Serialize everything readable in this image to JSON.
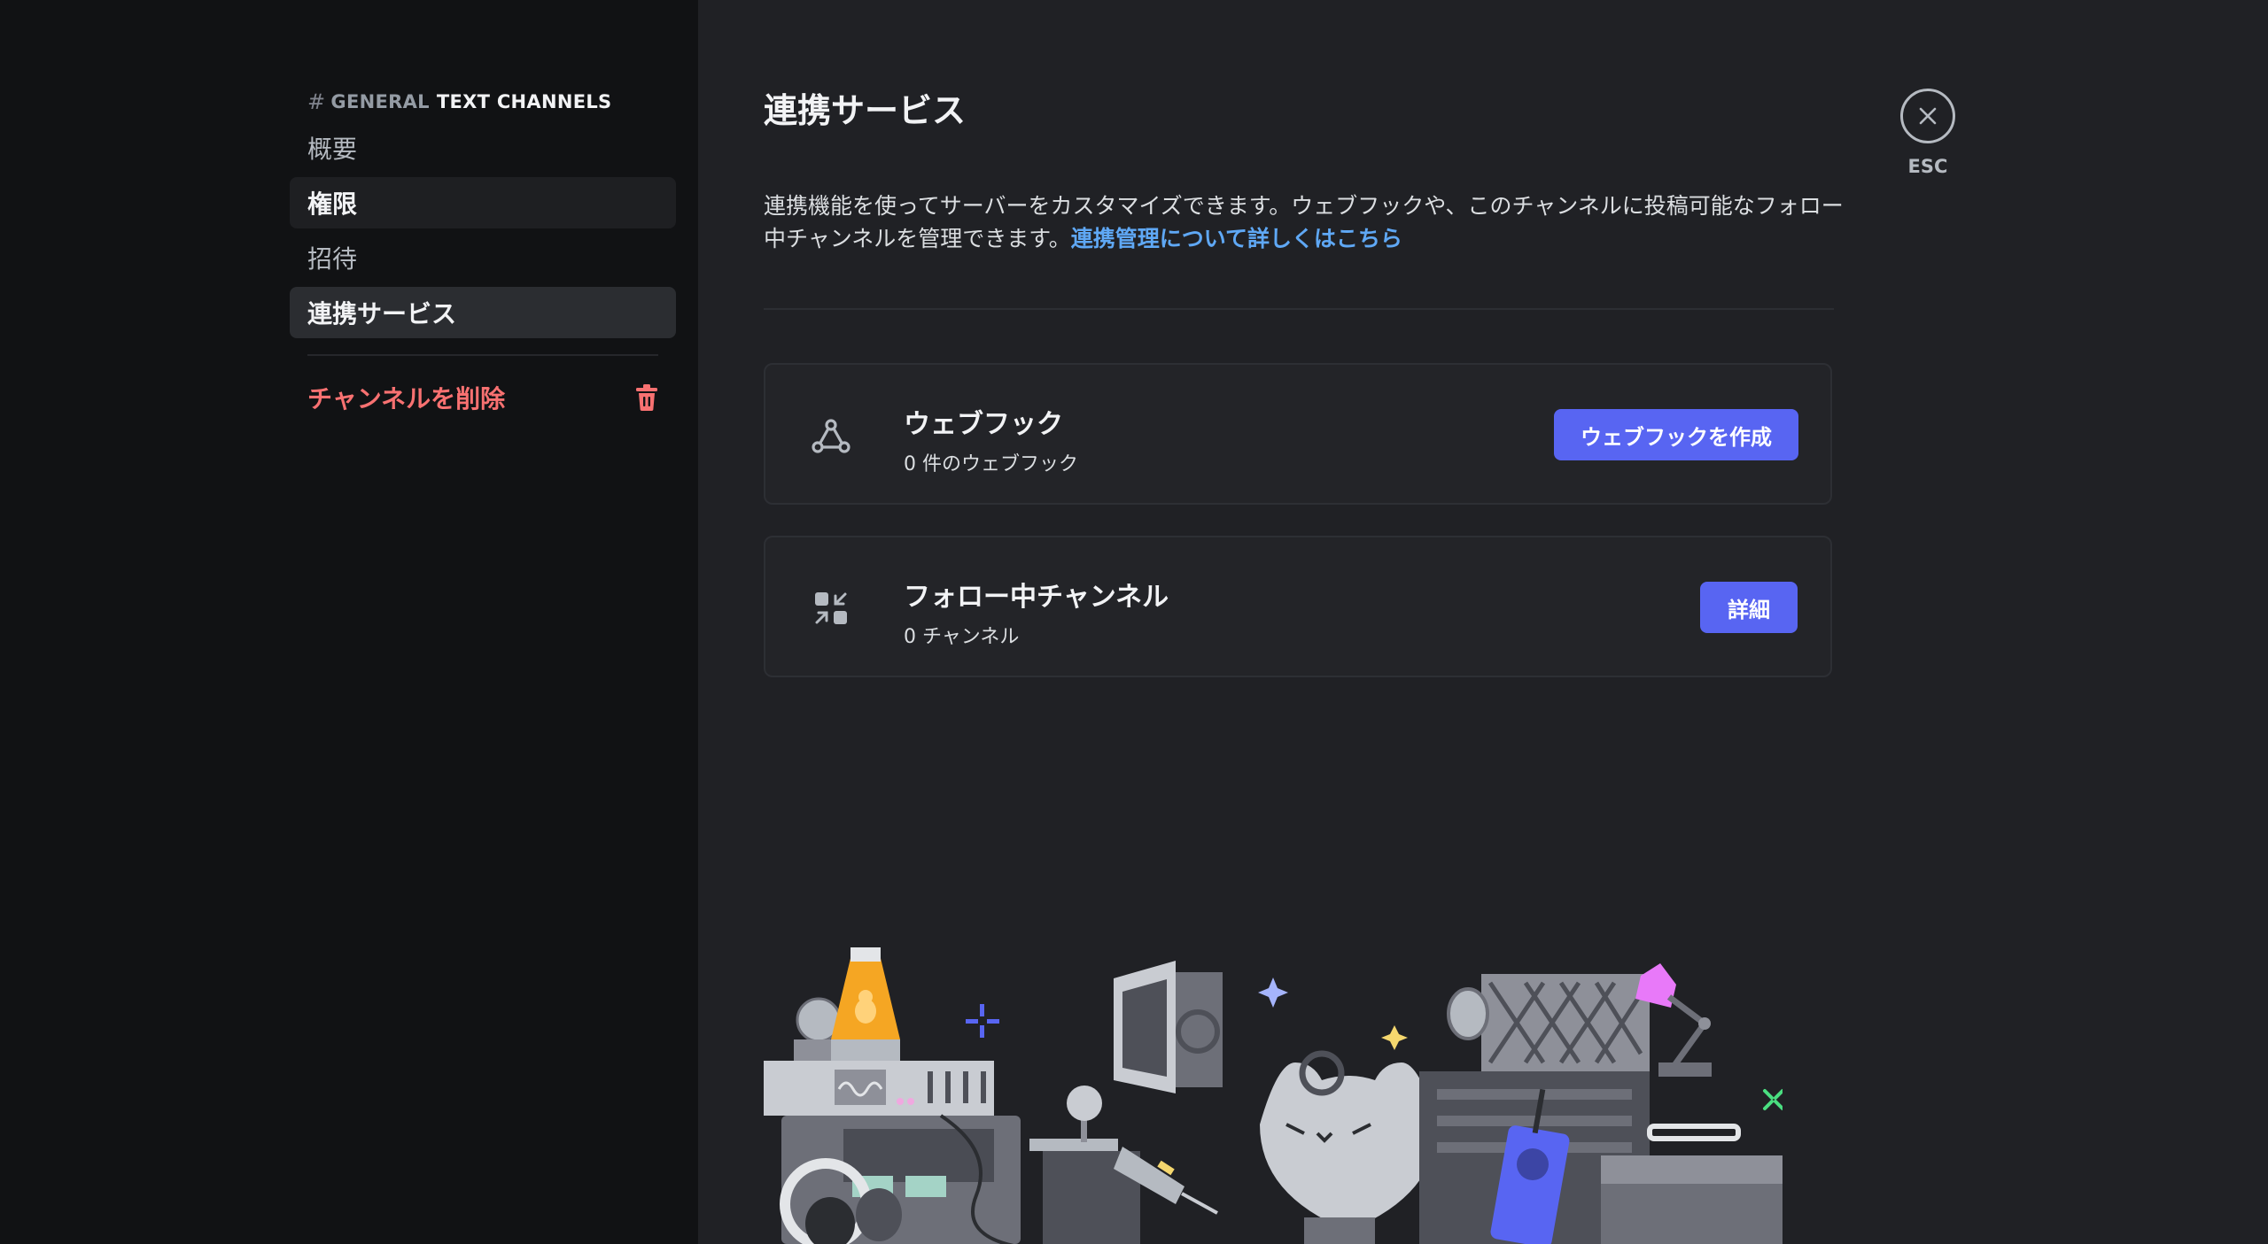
{
  "sidebar": {
    "header_hash": "#",
    "header_channel": "GENERAL",
    "header_category": "TEXT CHANNELS",
    "items": [
      {
        "label": "概要"
      },
      {
        "label": "権限"
      },
      {
        "label": "招待"
      },
      {
        "label": "連携サービス"
      }
    ],
    "delete_label": "チャンネルを削除"
  },
  "main": {
    "title": "連携サービス",
    "description": "連携機能を使ってサーバーをカスタマイズできます。ウェブフックや、このチャンネルに投稿可能なフォロー中チャンネルを管理できます。",
    "learn_more": "連携管理について詳しくはこちら",
    "cards": [
      {
        "title": "ウェブフック",
        "subtitle": "0 件のウェブフック",
        "button": "ウェブフックを作成"
      },
      {
        "title": "フォロー中チャンネル",
        "subtitle": "0 チャンネル",
        "button": "詳細"
      }
    ],
    "close_label": "ESC"
  },
  "colors": {
    "accent": "#5865f2",
    "link": "#5fa8f5",
    "danger": "#f87171"
  }
}
